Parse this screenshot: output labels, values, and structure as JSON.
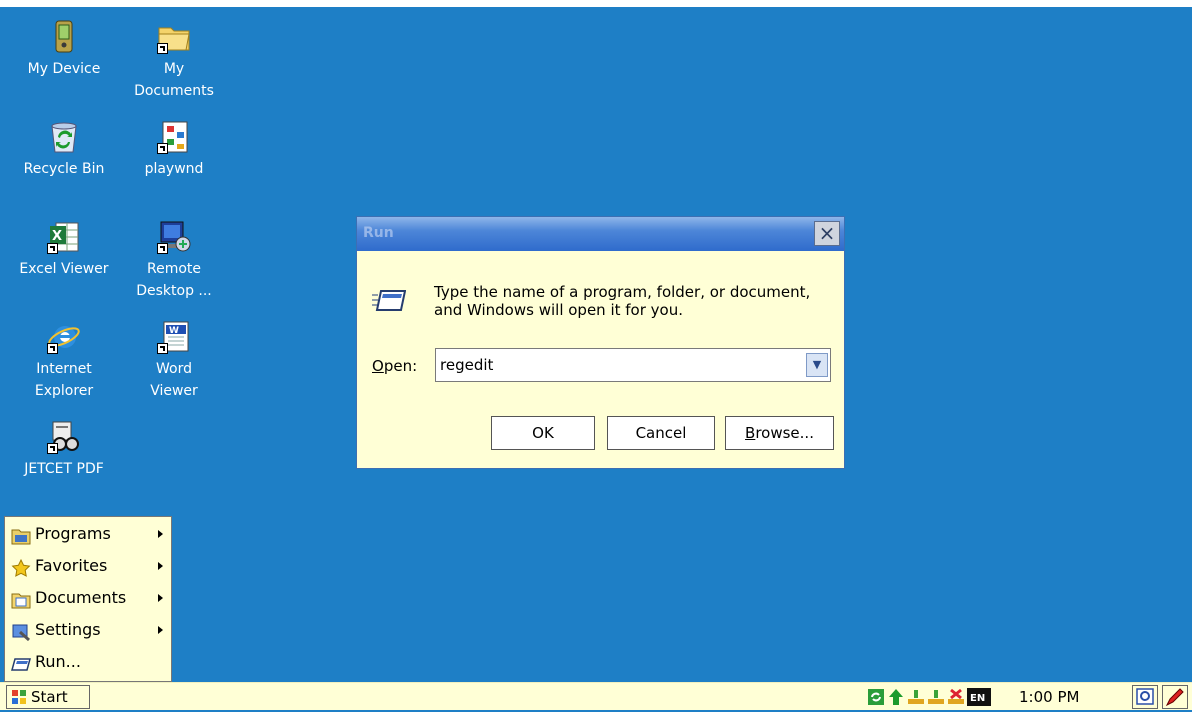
{
  "desktop": {
    "icons": [
      {
        "label": "My Device"
      },
      {
        "label": "My\nDocuments"
      },
      {
        "label": "Recycle Bin"
      },
      {
        "label": "playwnd"
      },
      {
        "label": "Excel Viewer"
      },
      {
        "label": "Remote\nDesktop ..."
      },
      {
        "label": "Internet\nExplorer"
      },
      {
        "label": "Word\nViewer"
      },
      {
        "label": "JETCET PDF"
      }
    ]
  },
  "run_dialog": {
    "title": "Run",
    "close_label": "×",
    "message": "Type the name of a program, folder, or document, and Windows will open it for you.",
    "open_label_prefix": "",
    "open_label": "Open:",
    "open_value": "regedit",
    "ok_label": "OK",
    "cancel_label": "Cancel",
    "browse_label": "Browse..."
  },
  "start_menu": {
    "items": [
      {
        "label": "Programs"
      },
      {
        "label": "Favorites"
      },
      {
        "label": "Documents"
      },
      {
        "label": "Settings"
      },
      {
        "label": "Run..."
      }
    ]
  },
  "taskbar": {
    "start_label": "Start",
    "input_indicator": "EN",
    "clock": "1:00 PM"
  }
}
